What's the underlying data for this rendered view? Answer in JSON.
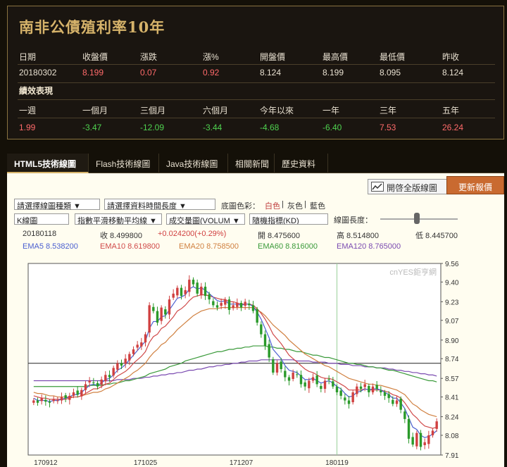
{
  "quote": {
    "title": "南非公債殖利率10年",
    "headers": [
      "日期",
      "收盤價",
      "漲跌",
      "漲%",
      "開盤價",
      "最高價",
      "最低價",
      "昨收"
    ],
    "values": [
      "20180302",
      "8.199",
      "0.07",
      "0.92",
      "8.124",
      "8.199",
      "8.095",
      "8.124"
    ],
    "perf_title": "績效表現",
    "perf_headers": [
      "一週",
      "一個月",
      "三個月",
      "六個月",
      "今年以來",
      "一年",
      "三年",
      "五年"
    ],
    "perf_values": [
      "1.99",
      "-3.47",
      "-12.09",
      "-3.44",
      "-4.68",
      "-6.40",
      "7.53",
      "26.24"
    ]
  },
  "tabs": [
    "HTML5技術線圖",
    "Flash技術線圖",
    "Java技術線圖",
    "相關新聞",
    "歷史資料"
  ],
  "toolbar": {
    "full_chart": "開啓全版線圖",
    "refresh": "更新報價",
    "chart_type_select": "請選擇線圖種類 ▼",
    "period_select": "請選擇資料時間長度 ▼",
    "bg_label": "底圖色彩：",
    "bg_white": "白色",
    "bg_gray": "灰色",
    "bg_blue": "藍色",
    "kline_select": "K線圖",
    "ma_select": "指數平滑移動平均線 ▼",
    "volume_select": "成交量圖(VOLUM ▼",
    "indicator_select": "隨機指標(KD)",
    "length_label": "線圖長度："
  },
  "info": {
    "date": "20180118",
    "close": "收 8.499800",
    "change": "+0.024200(+0.29%)",
    "open": "開 8.475600",
    "high": "高 8.514800",
    "low": "低 8.445700",
    "ema5": "EMA5 8.538200",
    "ema10": "EMA10 8.619800",
    "ema20": "EMA20 8.758500",
    "ema60": "EMA60 8.816000",
    "ema120": "EMA120 8.765000"
  },
  "colors": {
    "ema5": "#4a5fd0",
    "ema10": "#d04a4a",
    "ema20": "#d08040",
    "ema60": "#3a9a3a",
    "ema120": "#7a4ab0",
    "up": "#d04040",
    "down": "#2a9a2a",
    "accent": "#d6b36a"
  },
  "chart_data": {
    "type": "candlestick",
    "watermark": "cnYES鉅亨網",
    "ylim": [
      7.91,
      9.56
    ],
    "y_ticks": [
      "9.56",
      "9.40",
      "9.23",
      "9.07",
      "8.90",
      "8.74",
      "8.57",
      "8.41",
      "8.24",
      "8.08",
      "7.91"
    ],
    "x_ticks": [
      "170912",
      "171025",
      "171207",
      "180119"
    ],
    "crosshair_y": 8.7,
    "closes": [
      8.38,
      8.36,
      8.4,
      8.37,
      8.36,
      8.39,
      8.38,
      8.41,
      8.4,
      8.42,
      8.45,
      8.43,
      8.47,
      8.52,
      8.55,
      8.53,
      8.5,
      8.56,
      8.6,
      8.58,
      8.66,
      8.7,
      8.68,
      8.74,
      8.78,
      8.82,
      8.86,
      8.88,
      8.95,
      9.2,
      9.15,
      9.05,
      9.18,
      9.12,
      9.25,
      9.3,
      9.35,
      9.28,
      9.33,
      9.42,
      9.38,
      9.3,
      9.36,
      9.28,
      9.25,
      9.2,
      9.18,
      9.22,
      9.25,
      9.16,
      9.2,
      9.22,
      9.18,
      9.23,
      9.2,
      9.15,
      9.05,
      8.95,
      8.85,
      8.75,
      8.62,
      8.7,
      8.65,
      8.58,
      8.55,
      8.62,
      8.6,
      8.52,
      8.5,
      8.55,
      8.58,
      8.52,
      8.48,
      8.55,
      8.56,
      8.5,
      8.45,
      8.42,
      8.38,
      8.35,
      8.45,
      8.5,
      8.48,
      8.52,
      8.45,
      8.5,
      8.48,
      8.45,
      8.42,
      8.4,
      8.35,
      8.38,
      8.3,
      8.22,
      8.05,
      8.0,
      8.1,
      7.98,
      8.02,
      8.08,
      8.12,
      8.2
    ],
    "ema5": [
      8.4,
      8.38,
      8.38,
      8.38,
      8.37,
      8.38,
      8.38,
      8.39,
      8.4,
      8.41,
      8.43,
      8.43,
      8.45,
      8.48,
      8.51,
      8.52,
      8.51,
      8.53,
      8.56,
      8.57,
      8.6,
      8.64,
      8.66,
      8.69,
      8.73,
      8.77,
      8.81,
      8.85,
      8.89,
      9.0,
      9.06,
      9.06,
      9.1,
      9.11,
      9.16,
      9.21,
      9.26,
      9.27,
      9.29,
      9.34,
      9.36,
      9.34,
      9.35,
      9.33,
      9.3,
      9.27,
      9.24,
      9.23,
      9.24,
      9.21,
      9.21,
      9.21,
      9.2,
      9.21,
      9.21,
      9.19,
      9.14,
      9.08,
      9.0,
      8.92,
      8.82,
      8.78,
      8.74,
      8.68,
      8.64,
      8.63,
      8.62,
      8.59,
      8.56,
      8.56,
      8.57,
      8.55,
      8.53,
      8.54,
      8.55,
      8.53,
      8.5,
      8.48,
      8.44,
      8.41,
      8.42,
      8.45,
      8.46,
      8.48,
      8.47,
      8.48,
      8.48,
      8.47,
      8.45,
      8.43,
      8.4,
      8.4,
      8.36,
      8.31,
      8.23,
      8.15,
      8.13,
      8.08,
      8.06,
      8.07,
      8.09,
      8.12
    ],
    "ema10": [
      8.42,
      8.41,
      8.4,
      8.4,
      8.39,
      8.39,
      8.39,
      8.39,
      8.39,
      8.4,
      8.41,
      8.41,
      8.42,
      8.44,
      8.46,
      8.48,
      8.48,
      8.5,
      8.52,
      8.53,
      8.56,
      8.59,
      8.61,
      8.63,
      8.66,
      8.7,
      8.73,
      8.76,
      8.8,
      8.88,
      8.93,
      8.95,
      9.0,
      9.02,
      9.06,
      9.1,
      9.15,
      9.17,
      9.2,
      9.24,
      9.27,
      9.28,
      9.29,
      9.29,
      9.28,
      9.27,
      9.26,
      9.25,
      9.25,
      9.23,
      9.23,
      9.22,
      9.21,
      9.21,
      9.21,
      9.2,
      9.17,
      9.13,
      9.08,
      9.02,
      8.95,
      8.91,
      8.87,
      8.82,
      8.77,
      8.74,
      8.71,
      8.68,
      8.65,
      8.63,
      8.62,
      8.6,
      8.58,
      8.57,
      8.57,
      8.56,
      8.54,
      8.52,
      8.5,
      8.47,
      8.47,
      8.47,
      8.47,
      8.48,
      8.47,
      8.47,
      8.47,
      8.47,
      8.46,
      8.45,
      8.43,
      8.42,
      8.4,
      8.36,
      8.31,
      8.26,
      8.23,
      8.19,
      8.16,
      8.15,
      8.14,
      8.15
    ],
    "ema20": [
      8.45,
      8.44,
      8.44,
      8.43,
      8.42,
      8.42,
      8.41,
      8.41,
      8.41,
      8.41,
      8.41,
      8.41,
      8.42,
      8.43,
      8.44,
      8.45,
      8.45,
      8.46,
      8.48,
      8.49,
      8.51,
      8.53,
      8.55,
      8.57,
      8.59,
      8.62,
      8.64,
      8.67,
      8.7,
      8.75,
      8.79,
      8.82,
      8.86,
      8.88,
      8.92,
      8.95,
      8.99,
      9.02,
      9.05,
      9.08,
      9.11,
      9.13,
      9.15,
      9.16,
      9.17,
      9.17,
      9.17,
      9.18,
      9.18,
      9.18,
      9.18,
      9.18,
      9.18,
      9.18,
      9.18,
      9.18,
      9.16,
      9.14,
      9.11,
      9.07,
      9.03,
      9.0,
      8.97,
      8.94,
      8.9,
      8.87,
      8.84,
      8.81,
      8.78,
      8.76,
      8.74,
      8.72,
      8.7,
      8.68,
      8.67,
      8.65,
      8.63,
      8.61,
      8.59,
      8.57,
      8.56,
      8.55,
      8.54,
      8.53,
      8.52,
      8.52,
      8.51,
      8.51,
      8.5,
      8.49,
      8.48,
      8.47,
      8.45,
      8.43,
      8.39,
      8.35,
      8.33,
      8.3,
      8.28,
      8.26,
      8.25,
      8.24
    ],
    "ema60": [
      8.5,
      8.5,
      8.5,
      8.5,
      8.5,
      8.5,
      8.5,
      8.5,
      8.5,
      8.5,
      8.5,
      8.5,
      8.5,
      8.5,
      8.51,
      8.51,
      8.51,
      8.51,
      8.52,
      8.52,
      8.53,
      8.53,
      8.54,
      8.55,
      8.55,
      8.56,
      8.57,
      8.58,
      8.59,
      8.61,
      8.62,
      8.63,
      8.64,
      8.65,
      8.67,
      8.68,
      8.69,
      8.7,
      8.72,
      8.73,
      8.74,
      8.75,
      8.76,
      8.77,
      8.78,
      8.79,
      8.8,
      8.8,
      8.81,
      8.82,
      8.82,
      8.83,
      8.83,
      8.84,
      8.84,
      8.85,
      8.85,
      8.85,
      8.85,
      8.84,
      8.84,
      8.83,
      8.83,
      8.82,
      8.82,
      8.81,
      8.8,
      8.8,
      8.79,
      8.78,
      8.77,
      8.77,
      8.76,
      8.75,
      8.75,
      8.74,
      8.73,
      8.72,
      8.71,
      8.7,
      8.7,
      8.69,
      8.69,
      8.68,
      8.67,
      8.67,
      8.66,
      8.66,
      8.65,
      8.64,
      8.64,
      8.63,
      8.62,
      8.61,
      8.6,
      8.59,
      8.58,
      8.57,
      8.56,
      8.55,
      8.55,
      8.54
    ],
    "ema120": [
      8.55,
      8.55,
      8.55,
      8.55,
      8.55,
      8.55,
      8.55,
      8.55,
      8.55,
      8.55,
      8.55,
      8.55,
      8.55,
      8.55,
      8.55,
      8.55,
      8.55,
      8.55,
      8.55,
      8.55,
      8.55,
      8.56,
      8.56,
      8.56,
      8.56,
      8.57,
      8.57,
      8.57,
      8.58,
      8.58,
      8.59,
      8.59,
      8.6,
      8.6,
      8.61,
      8.61,
      8.62,
      8.62,
      8.63,
      8.64,
      8.64,
      8.65,
      8.65,
      8.66,
      8.67,
      8.67,
      8.68,
      8.68,
      8.69,
      8.69,
      8.7,
      8.7,
      8.71,
      8.71,
      8.72,
      8.72,
      8.72,
      8.73,
      8.73,
      8.73,
      8.73,
      8.73,
      8.73,
      8.73,
      8.73,
      8.73,
      8.72,
      8.72,
      8.72,
      8.72,
      8.71,
      8.71,
      8.71,
      8.71,
      8.7,
      8.7,
      8.7,
      8.69,
      8.69,
      8.69,
      8.68,
      8.68,
      8.68,
      8.67,
      8.67,
      8.67,
      8.66,
      8.66,
      8.66,
      8.65,
      8.65,
      8.64,
      8.64,
      8.63,
      8.63,
      8.62,
      8.62,
      8.61,
      8.61,
      8.6,
      8.6,
      8.59
    ]
  }
}
